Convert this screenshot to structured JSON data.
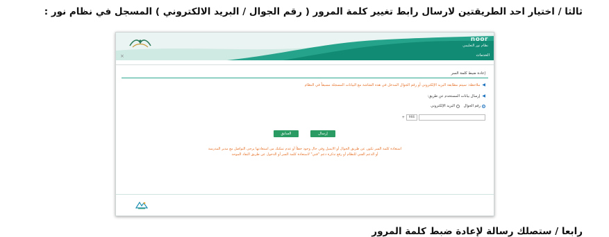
{
  "heading": "ثالثا / اختيار احد الطريقتين لارسال رابط تغيير كلمة المرور ( رقم الجوال / البريد الالكتروني ) المسجل في نظام نور :",
  "next_heading": "رابعا / ستصلك رسالة لإعادة ضبط كلمة المرور",
  "banner": {
    "logo_text": "noor",
    "logo_subtext": "نظام نور التعليمي",
    "nav_tab": "الخدمات",
    "close_label": "×"
  },
  "page": {
    "title": "إعادة ضبط كلمة السر",
    "note": "ملاحظة: سيتم مطابقة البريد الإلكتروني أو رقم الجوال المدخل في هذه الشاشة مع البيانات المسجلة مسبقاً في النظام",
    "send_via": "إرسال بيانات المستخدم عن طريق:",
    "options": [
      "رقم الجوال",
      "البريد الإلكتروني"
    ],
    "selected_option": "رقم الجوال",
    "phone_prefix": "+",
    "country_code": "966",
    "phone_value": ""
  },
  "buttons": {
    "send": "إرسال",
    "previous": "السابق"
  },
  "help": {
    "line1": "استعادة كلمة السر تكون عن طريق الجوال أو الايميل وفي حال وجود خطأ أو عدم تمكنك من استعادتها يرجى التواصل مع مدير المدرسة",
    "line2": "أو الدعم الفني للنظام أو رفع تذكرة دعم \"فني\" لاستعادة كلمة السر أو الدخول عن طريق النفاذ الموحد"
  },
  "colors": {
    "accent": "#128b75",
    "banner_light": "#cfe9e3",
    "note": "#e6722a",
    "button": "#2a9b63"
  },
  "icons": {
    "banner_logo": "vision-2030-logo",
    "footer": "ministry-logo-icon",
    "bullet": "triangle-bullet-icon"
  }
}
